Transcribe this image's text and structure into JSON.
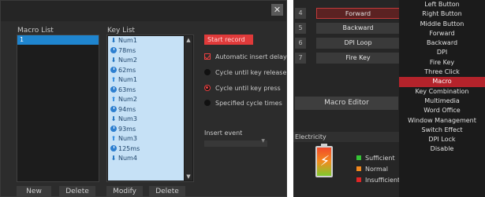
{
  "editor": {
    "close_icon": "✕",
    "macro_list_title": "Macro List",
    "key_list_title": "Key List",
    "macros": [
      "1"
    ],
    "keys": [
      {
        "icon": "key-down-icon",
        "label": "Num1"
      },
      {
        "icon": "clock-icon",
        "label": "78ms"
      },
      {
        "icon": "key-down-icon",
        "label": "Num2"
      },
      {
        "icon": "clock-icon",
        "label": "62ms"
      },
      {
        "icon": "key-up-icon",
        "label": "Num1"
      },
      {
        "icon": "clock-icon",
        "label": "63ms"
      },
      {
        "icon": "key-up-icon",
        "label": "Num2"
      },
      {
        "icon": "clock-icon",
        "label": "94ms"
      },
      {
        "icon": "key-down-icon",
        "label": "Num3"
      },
      {
        "icon": "clock-icon",
        "label": "93ms"
      },
      {
        "icon": "key-up-icon",
        "label": "Num3"
      },
      {
        "icon": "clock-icon",
        "label": "125ms"
      },
      {
        "icon": "key-down-icon",
        "label": "Num4"
      }
    ],
    "start_record": "Start record",
    "options": [
      {
        "type": "checkbox",
        "checked": true,
        "label": "Automatic insert delay"
      },
      {
        "type": "radio",
        "checked": false,
        "label": "Cycle until key release"
      },
      {
        "type": "radio",
        "checked": true,
        "label": "Cycle until key press"
      },
      {
        "type": "radio",
        "checked": false,
        "label": "Specified cycle times"
      }
    ],
    "insert_event_label": "Insert event",
    "buttons": {
      "new": "New",
      "delete": "Delete",
      "modify": "Modify",
      "delete2": "Delete"
    }
  },
  "device": {
    "slots": [
      {
        "num": "4",
        "label": "Forward",
        "active": true
      },
      {
        "num": "5",
        "label": "Backward",
        "active": false
      },
      {
        "num": "6",
        "label": "DPI Loop",
        "active": false
      },
      {
        "num": "7",
        "label": "Fire Key",
        "active": false
      }
    ],
    "macro_editor_button": "Macro Editor",
    "electricity_title": "Electricity",
    "legend": [
      {
        "label": "Sufficient",
        "color": "#35c435"
      },
      {
        "label": "Normal",
        "color": "#f2891e"
      },
      {
        "label": "Insufficient",
        "color": "#e02525"
      }
    ],
    "menu": [
      "Left Button",
      "Right Button",
      "Middle Button",
      "Forward",
      "Backward",
      "DPI",
      "Fire Key",
      "Three Click",
      "Macro",
      "Key Combination",
      "Multimedia",
      "Word Office",
      "Window Management",
      "Switch Effect",
      "DPI Lock",
      "Disable"
    ],
    "menu_selected": "Macro"
  }
}
